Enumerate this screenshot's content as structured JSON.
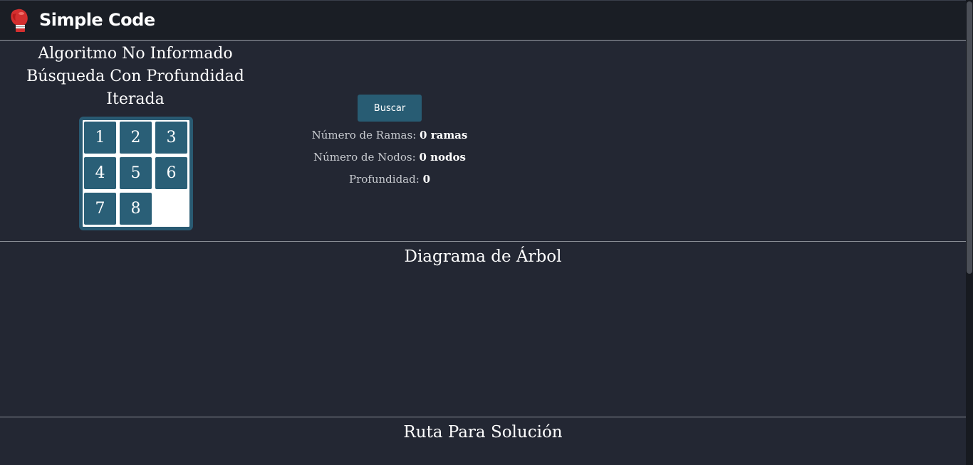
{
  "navbar": {
    "brand_name": "Simple Code",
    "brand_icon": "boxing-glove-icon",
    "brand_color": "#d32f2f"
  },
  "algorithm": {
    "title_lines": [
      "Algoritmo No Informado",
      "Búsqueda Con Profundidad",
      "Iterada"
    ]
  },
  "puzzle": {
    "tiles": [
      "1",
      "2",
      "3",
      "4",
      "5",
      "6",
      "7",
      "8",
      ""
    ],
    "tile_color": "#2a5f77"
  },
  "controls": {
    "search_label": "Buscar"
  },
  "stats": {
    "branches_label": "Número de Ramas:",
    "branches_value": "0 ramas",
    "nodes_label": "Número de Nodos:",
    "nodes_value": "0 nodos",
    "depth_label": "Profundidad:",
    "depth_value": "0"
  },
  "sections": {
    "tree_title": "Diagrama de Árbol",
    "route_title": "Ruta Para Solución"
  }
}
